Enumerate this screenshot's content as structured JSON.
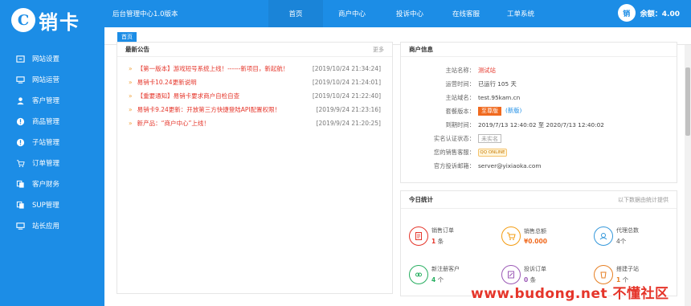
{
  "logo": {
    "mark": "C",
    "text": "销卡"
  },
  "sidebar": {
    "items": [
      {
        "label": "网站设置",
        "icon": "website-settings-icon"
      },
      {
        "label": "网站运营",
        "icon": "monitor-icon"
      },
      {
        "label": "客户管理",
        "icon": "user-icon"
      },
      {
        "label": "商品管理",
        "icon": "info-icon"
      },
      {
        "label": "子站管理",
        "icon": "info-icon"
      },
      {
        "label": "订单管理",
        "icon": "cart-icon"
      },
      {
        "label": "客户财务",
        "icon": "copy-icon"
      },
      {
        "label": "SUP管理",
        "icon": "copy-icon"
      },
      {
        "label": "站长应用",
        "icon": "monitor-icon"
      }
    ]
  },
  "topbar": {
    "title": "后台管理中心1.0版本",
    "menu": [
      "首页",
      "商户中心",
      "投诉中心",
      "在线客服",
      "工单系统"
    ],
    "avatar_text": "销",
    "balance": "余额：4.00"
  },
  "tabbar": {
    "tab": "首页"
  },
  "news": {
    "title": "最新公告",
    "more": "更多",
    "items": [
      {
        "text": "【第一版本】游戏短号系统上线！------新项目，新起航！",
        "date": "[2019/10/24 21:34:24]"
      },
      {
        "text": "易销卡10.24更新说明",
        "date": "[2019/10/24 21:24:01]"
      },
      {
        "text": "【重要通知】易销卡要求商户自检自查",
        "date": "[2019/10/24 21:22:40]"
      },
      {
        "text": "易销卡9.24更新：开放第三方快捷登陆API配置权限！",
        "date": "[2019/9/24 21:23:16]"
      },
      {
        "text": "新产品：“商户中心”上线！",
        "date": "[2019/9/24 21:20:25]"
      }
    ],
    "arrow": "»"
  },
  "info": {
    "title": "商户信息",
    "rows": {
      "name_k": "主站名称：",
      "name_v": "测试站",
      "runtime_k": "运营时间：",
      "runtime_v": "已运行 105 天",
      "domain_k": "主站域名：",
      "domain_v": "test.95kam.cn",
      "package_k": "套餐版本：",
      "upgrade_btn": "至尊版",
      "new_ver": "(新版)",
      "expire_k": "到期时间：",
      "expire_v": "2019/7/13 12:40:02 至 2020/7/13 12:40:02",
      "realname_k": "实名认证状态：",
      "realname_v": "未实名",
      "sales_k": "您的销售客服：",
      "qq_text": "QQ ONLINE",
      "complaint_k": "官方投诉邮箱：",
      "complaint_v": "server@yixiaoka.com"
    }
  },
  "stats": {
    "title": "今日统计",
    "note": "以下数据由统计提供",
    "items": [
      {
        "label": "销售订单",
        "value": "1",
        "unit": " 条",
        "color": "#e5352a"
      },
      {
        "label": "销售总额",
        "value": "¥0.000",
        "unit": "",
        "color": "#f39c12"
      },
      {
        "label": "代理总数",
        "value": "",
        "unit": "4个",
        "color": "#3498db"
      },
      {
        "label": "新注册客户",
        "value": "4",
        "unit": " 个",
        "color": "#27ae60"
      },
      {
        "label": "投诉订单",
        "value": "0",
        "unit": " 条",
        "color": "#9b59b6"
      },
      {
        "label": "搭建子站",
        "value": "1",
        "unit": " 个",
        "color": "#e67e22"
      }
    ]
  },
  "watermark": "www.budong.net 不懂社区",
  "colors": {
    "primary": "#1c8de6",
    "accent_red": "#e5352a",
    "accent_orange": "#f06a1f"
  }
}
